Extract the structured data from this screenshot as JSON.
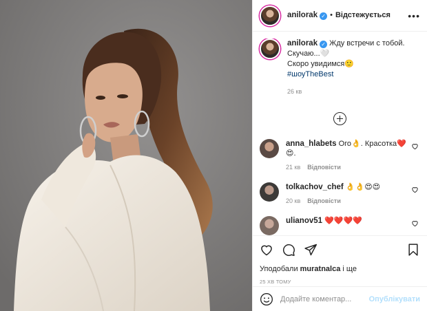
{
  "post": {
    "author": "anilorak",
    "follow_state": "Відстежується",
    "separator": "•",
    "more": "•••",
    "verified_mark": "✓",
    "caption_lines": [
      "Жду встречи с тобой.",
      "Скучаю...🤍",
      "Скоро увидимся🙂"
    ],
    "hashtag": "#шоуTheBest",
    "caption_time": "26 кв"
  },
  "comments": [
    {
      "user": "anna_hlabets",
      "text": "Ого👌. Красотка❤️😍.",
      "time": "21 кв",
      "reply": "Відповісти",
      "avatar_color": "#5a4a44"
    },
    {
      "user": "tolkachov_chef",
      "text": "👌👌😍😍",
      "time": "20 кв",
      "reply": "Відповісти",
      "avatar_color": "#3c3a38"
    },
    {
      "user": "ulianov51",
      "text": "❤️❤️❤️❤️",
      "time": "",
      "reply": "",
      "avatar_color": "#7a6a62"
    }
  ],
  "likes": {
    "prefix": "Уподобали ",
    "user": "muratnalca",
    "suffix": " і ще"
  },
  "posted_time": "25 хв тому",
  "comment_box": {
    "placeholder": "Додайте коментар...",
    "publish": "Опублікувати"
  },
  "icons": [
    "heart-icon",
    "comment-icon",
    "share-icon",
    "bookmark-icon",
    "emoji-icon",
    "plus-circle-icon"
  ]
}
